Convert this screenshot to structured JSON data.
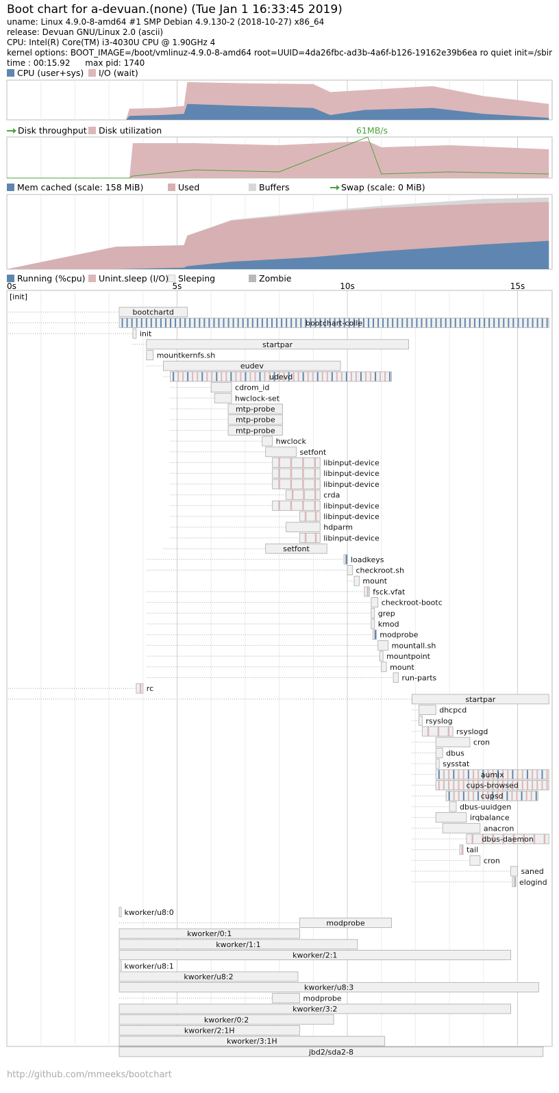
{
  "header": {
    "title": "Boot chart for a-devuan.(none) (Tue Jan  1 16:33:45 2019)",
    "uname": "uname: Linux 4.9.0-8-amd64 #1 SMP Debian 4.9.130-2 (2018-10-27) x86_64",
    "release": "release: Devuan GNU/Linux 2.0 (ascii)",
    "cpu": "CPU: Intel(R) Core(TM) i3-4030U CPU @ 1.90GHz 4",
    "kernel": "kernel options: BOOT_IMAGE=/boot/vmlinuz-4.9.0-8-amd64 root=UUID=4da26fbc-ad3b-4a6f-b126-19162e39b6ea ro quiet init=/sbin/bootchartd",
    "time": "time : 00:15.92",
    "maxpid": "max pid: 1740"
  },
  "legends": {
    "cpu_user": "CPU (user+sys)",
    "io_wait": "I/O (wait)",
    "disk_tp": "Disk throughput",
    "disk_util": "Disk utilization",
    "disk_peak": "61MB/s",
    "mem_cached": "Mem cached (scale: 158 MiB)",
    "mem_used": "Used",
    "mem_buffers": "Buffers",
    "swap": "Swap (scale: 0 MiB)",
    "running": "Running (%cpu)",
    "unint": "Unint.sleep (I/O)",
    "sleeping": "Sleeping",
    "zombie": "Zombie"
  },
  "colors": {
    "cpu": "#5f86b0",
    "io": "#dcb7b9",
    "disk_tp": "#4aa33b",
    "mem_cached": "#5f86b0",
    "mem_used": "#d6b0b2",
    "buffers": "#d8d8d8",
    "sleeping_fill": "#f0f0f0",
    "zombie": "#b8b8b8"
  },
  "footer": "http://github.com/mmeeks/bootchart",
  "chart_data": {
    "type": "bootchart",
    "duration_s": 15.92,
    "time_ticks": [
      "0s",
      "5s",
      "10s",
      "15s"
    ],
    "tick_seconds": [
      0,
      5,
      10,
      15
    ],
    "cpu_io_series": [
      {
        "t": 0,
        "cpu": 0,
        "io": 0
      },
      {
        "t": 3.5,
        "cpu": 0,
        "io": 0
      },
      {
        "t": 3.6,
        "cpu": 10,
        "io": 28
      },
      {
        "t": 4.5,
        "cpu": 12,
        "io": 30
      },
      {
        "t": 5.2,
        "cpu": 15,
        "io": 35
      },
      {
        "t": 5.3,
        "cpu": 40,
        "io": 95
      },
      {
        "t": 7.0,
        "cpu": 35,
        "io": 92
      },
      {
        "t": 9.0,
        "cpu": 30,
        "io": 90
      },
      {
        "t": 9.5,
        "cpu": 12,
        "io": 70
      },
      {
        "t": 10.5,
        "cpu": 25,
        "io": 75
      },
      {
        "t": 12.5,
        "cpu": 30,
        "io": 85
      },
      {
        "t": 14.0,
        "cpu": 15,
        "io": 60
      },
      {
        "t": 15.0,
        "cpu": 10,
        "io": 50
      },
      {
        "t": 15.92,
        "cpu": 5,
        "io": 40
      }
    ],
    "disk_series": [
      {
        "t": 0,
        "util": 0,
        "tp": 0
      },
      {
        "t": 3.6,
        "util": 0,
        "tp": 0
      },
      {
        "t": 3.7,
        "util": 85,
        "tp": 5
      },
      {
        "t": 5.5,
        "util": 85,
        "tp": 20
      },
      {
        "t": 8.0,
        "util": 80,
        "tp": 15
      },
      {
        "t": 10.6,
        "util": 90,
        "tp": 100
      },
      {
        "t": 11.0,
        "util": 75,
        "tp": 10
      },
      {
        "t": 13.0,
        "util": 80,
        "tp": 15
      },
      {
        "t": 15.92,
        "util": 70,
        "tp": 10
      }
    ],
    "mem_series": [
      {
        "t": 0,
        "used": 0,
        "cached": 0,
        "buffers": 0
      },
      {
        "t": 3.2,
        "used": 30,
        "cached": 0,
        "buffers": 30
      },
      {
        "t": 5.2,
        "used": 32,
        "cached": 2,
        "buffers": 32
      },
      {
        "t": 5.3,
        "used": 45,
        "cached": 4,
        "buffers": 45
      },
      {
        "t": 6.6,
        "used": 65,
        "cached": 10,
        "buffers": 66
      },
      {
        "t": 9.0,
        "used": 75,
        "cached": 16,
        "buffers": 77
      },
      {
        "t": 11.0,
        "used": 82,
        "cached": 24,
        "buffers": 85
      },
      {
        "t": 14.0,
        "used": 88,
        "cached": 33,
        "buffers": 94
      },
      {
        "t": 15.92,
        "used": 90,
        "cached": 38,
        "buffers": 96
      }
    ],
    "processes": [
      {
        "name": "[init]",
        "start": 0,
        "end": 15.92,
        "parent": null,
        "label_inside": false,
        "root": true
      },
      {
        "name": "bootchartd",
        "start": 3.3,
        "end": 5.3,
        "parent": 0,
        "label_inside": true
      },
      {
        "name": "bootchart-colle",
        "start": 3.3,
        "end": 15.92,
        "parent": 0,
        "label_inside": true,
        "activity": "cpu-dense"
      },
      {
        "name": "init",
        "start": 3.7,
        "end": 3.8,
        "parent": 0
      },
      {
        "name": "startpar",
        "start": 4.1,
        "end": 11.8,
        "parent": 3,
        "label_inside": true
      },
      {
        "name": "mountkernfs.sh",
        "start": 4.1,
        "end": 4.3,
        "parent": 4
      },
      {
        "name": "eudev",
        "start": 4.6,
        "end": 9.8,
        "parent": 4,
        "label_inside": true
      },
      {
        "name": "udevd",
        "start": 4.8,
        "end": 11.3,
        "parent": 6,
        "label_inside": true,
        "activity": "mixed-dense"
      },
      {
        "name": "cdrom_id",
        "start": 6.0,
        "end": 6.6,
        "parent": 7
      },
      {
        "name": "hwclock-set",
        "start": 6.1,
        "end": 6.6,
        "parent": 7
      },
      {
        "name": "mtp-probe",
        "start": 6.5,
        "end": 8.1,
        "parent": 7,
        "label_inside": true
      },
      {
        "name": "mtp-probe",
        "start": 6.5,
        "end": 8.1,
        "parent": 7,
        "label_inside": true
      },
      {
        "name": "mtp-probe",
        "start": 6.5,
        "end": 8.1,
        "parent": 7,
        "label_inside": true
      },
      {
        "name": "hwclock",
        "start": 7.5,
        "end": 7.8,
        "parent": 7
      },
      {
        "name": "setfont",
        "start": 7.6,
        "end": 8.5,
        "parent": 7,
        "label_inside": true
      },
      {
        "name": "libinput-device",
        "start": 7.8,
        "end": 9.2,
        "parent": 7,
        "activity": "io"
      },
      {
        "name": "libinput-device",
        "start": 7.8,
        "end": 9.2,
        "parent": 7,
        "activity": "io"
      },
      {
        "name": "libinput-device",
        "start": 7.8,
        "end": 9.2,
        "parent": 7,
        "activity": "io"
      },
      {
        "name": "crda",
        "start": 8.2,
        "end": 9.2,
        "parent": 7,
        "label_inside": true,
        "activity": "io"
      },
      {
        "name": "libinput-device",
        "start": 7.8,
        "end": 9.2,
        "parent": 7,
        "activity": "io"
      },
      {
        "name": "libinput-device",
        "start": 8.6,
        "end": 9.2,
        "parent": 7,
        "activity": "io"
      },
      {
        "name": "hdparm",
        "start": 8.2,
        "end": 9.2,
        "parent": 7,
        "label_inside": true
      },
      {
        "name": "libinput-device",
        "start": 8.6,
        "end": 9.2,
        "parent": 7,
        "activity": "io"
      },
      {
        "name": "setfont",
        "start": 7.6,
        "end": 9.4,
        "parent": 6,
        "label_inside": true
      },
      {
        "name": "loadkeys",
        "start": 9.9,
        "end": 10.0,
        "parent": 4,
        "activity": "cpu"
      },
      {
        "name": "checkroot.sh",
        "start": 10.0,
        "end": 10.15,
        "parent": 4
      },
      {
        "name": "mount",
        "start": 10.2,
        "end": 10.35,
        "parent": 25
      },
      {
        "name": "fsck.vfat",
        "start": 10.5,
        "end": 10.65,
        "parent": 4,
        "activity": "io"
      },
      {
        "name": "checkroot-bootc",
        "start": 10.7,
        "end": 10.9,
        "parent": 4
      },
      {
        "name": "grep",
        "start": 10.7,
        "end": 10.8,
        "parent": 4
      },
      {
        "name": "kmod",
        "start": 10.7,
        "end": 10.8,
        "parent": 4
      },
      {
        "name": "modprobe",
        "start": 10.75,
        "end": 10.85,
        "parent": 4,
        "activity": "cpu"
      },
      {
        "name": "mountall.sh",
        "start": 10.9,
        "end": 11.2,
        "parent": 4
      },
      {
        "name": "mountpoint",
        "start": 10.95,
        "end": 11.05,
        "parent": 4
      },
      {
        "name": "mount",
        "start": 11.0,
        "end": 11.15,
        "parent": 4
      },
      {
        "name": "run-parts",
        "start": 11.35,
        "end": 11.5,
        "parent": 4
      },
      {
        "name": "rc",
        "start": 3.8,
        "end": 4.0,
        "parent": 0,
        "activity": "io"
      },
      {
        "name": "startpar",
        "start": 11.9,
        "end": 15.92,
        "parent": 0,
        "label_inside": true
      },
      {
        "name": "dhcpcd",
        "start": 12.1,
        "end": 12.6,
        "parent": 37,
        "label_inside": true
      },
      {
        "name": "rsyslog",
        "start": 12.1,
        "end": 12.2,
        "parent": 37
      },
      {
        "name": "rsyslogd",
        "start": 12.2,
        "end": 13.1,
        "parent": 37,
        "activity": "io"
      },
      {
        "name": "cron",
        "start": 12.6,
        "end": 13.6,
        "parent": 37,
        "label_inside": true
      },
      {
        "name": "dbus",
        "start": 12.6,
        "end": 12.8,
        "parent": 37
      },
      {
        "name": "sysstat",
        "start": 12.6,
        "end": 12.7,
        "parent": 37
      },
      {
        "name": "aumix",
        "start": 12.6,
        "end": 15.92,
        "parent": 37,
        "label_inside": true,
        "activity": "mixed-dense"
      },
      {
        "name": "cups-browsed",
        "start": 12.6,
        "end": 15.92,
        "parent": 37,
        "label_inside": true,
        "activity": "io-dense"
      },
      {
        "name": "cupsd",
        "start": 12.9,
        "end": 15.6,
        "parent": 37,
        "label_inside": true,
        "activity": "mixed-dense"
      },
      {
        "name": "dbus-uuidgen",
        "start": 13.0,
        "end": 13.2,
        "parent": 37
      },
      {
        "name": "irqbalance",
        "start": 12.6,
        "end": 13.5,
        "parent": 37
      },
      {
        "name": "anacron",
        "start": 12.8,
        "end": 13.9,
        "parent": 37
      },
      {
        "name": "dbus-daemon",
        "start": 13.5,
        "end": 15.92,
        "parent": 37,
        "label_inside": true,
        "activity": "io"
      },
      {
        "name": "tail",
        "start": 13.3,
        "end": 13.4,
        "parent": 37,
        "activity": "io"
      },
      {
        "name": "cron",
        "start": 13.6,
        "end": 13.9,
        "parent": 37
      },
      {
        "name": "saned",
        "start": 14.8,
        "end": 15.0,
        "parent": 37
      },
      {
        "name": "elogind",
        "start": 14.85,
        "end": 14.95,
        "parent": 37,
        "activity": "zombie"
      },
      {
        "name": "kworker/u8:0",
        "start": 3.3,
        "end": 3.35,
        "parent": null
      },
      {
        "name": "modprobe",
        "start": 8.6,
        "end": 11.3,
        "parent": null,
        "label_inside": true,
        "dotted_from": 3.3
      },
      {
        "name": "kworker/0:1",
        "start": 3.3,
        "end": 8.6,
        "parent": null,
        "label_inside": true
      },
      {
        "name": "kworker/1:1",
        "start": 3.3,
        "end": 10.3,
        "parent": null,
        "label_inside": true
      },
      {
        "name": "kworker/2:1",
        "start": 3.3,
        "end": 14.8,
        "parent": null,
        "label_inside": true
      },
      {
        "name": "kworker/u8:1",
        "start": 3.3,
        "end": 3.35,
        "parent": null
      },
      {
        "name": "kworker/u8:2",
        "start": 3.3,
        "end": 8.55,
        "parent": null,
        "label_inside": true
      },
      {
        "name": "kworker/u8:3",
        "start": 3.3,
        "end": 15.62,
        "parent": null,
        "label_inside": true
      },
      {
        "name": "modprobe",
        "start": 7.8,
        "end": 8.6,
        "parent": null,
        "dotted_from": 3.3
      },
      {
        "name": "kworker/3:2",
        "start": 3.3,
        "end": 14.8,
        "parent": null,
        "label_inside": true
      },
      {
        "name": "kworker/0:2",
        "start": 3.3,
        "end": 9.6,
        "parent": null,
        "label_inside": true
      },
      {
        "name": "kworker/2:1H",
        "start": 3.3,
        "end": 8.6,
        "parent": null,
        "label_inside": true
      },
      {
        "name": "kworker/3:1H",
        "start": 3.3,
        "end": 11.1,
        "parent": null,
        "label_inside": true
      },
      {
        "name": "jbd2/sda2-8",
        "start": 3.3,
        "end": 15.75,
        "parent": null,
        "label_inside": true
      }
    ]
  }
}
